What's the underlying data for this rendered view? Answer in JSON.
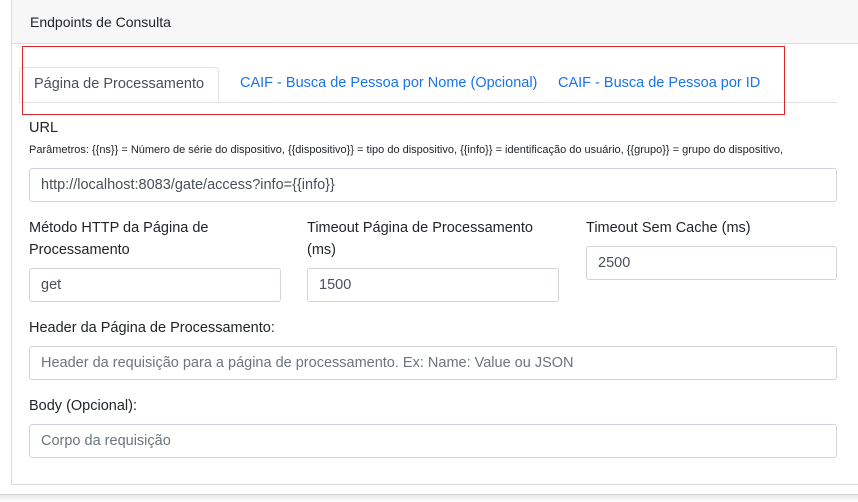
{
  "card": {
    "title": "Endpoints de Consulta"
  },
  "tabs": [
    {
      "label": "Página de Processamento",
      "active": true
    },
    {
      "label": "CAIF - Busca de Pessoa por Nome (Opcional)",
      "active": false
    },
    {
      "label": "CAIF - Busca de Pessoa por ID",
      "active": false
    }
  ],
  "url": {
    "label": "URL",
    "params": "Parâmetros: {{ns}} = Número de série do dispositivo, {{dispositivo}} = tipo do dispositivo, {{info}} = identificação do usuário, {{grupo}} = grupo do dispositivo,",
    "value": "http://localhost:8083/gate/access?info={{info}}"
  },
  "method": {
    "label_line1": "Método HTTP da Página de",
    "label_line2": "Processamento",
    "value": "get"
  },
  "timeout": {
    "label_line1": "Timeout Página de Processamento",
    "label_line2": "(ms)",
    "value": "1500"
  },
  "timeout_no_cache": {
    "label": "Timeout Sem Cache (ms)",
    "value": "2500"
  },
  "header": {
    "label": "Header da Página de Processamento:",
    "placeholder": "Header da requisição para a página de processamento. Ex: Name: Value ou JSON"
  },
  "body": {
    "label": "Body (Opcional):",
    "placeholder": "Corpo da requisição"
  },
  "colors": {
    "link": "#1a73e8",
    "highlight_border": "#d9262c",
    "header_bg": "#f7f7f7"
  }
}
